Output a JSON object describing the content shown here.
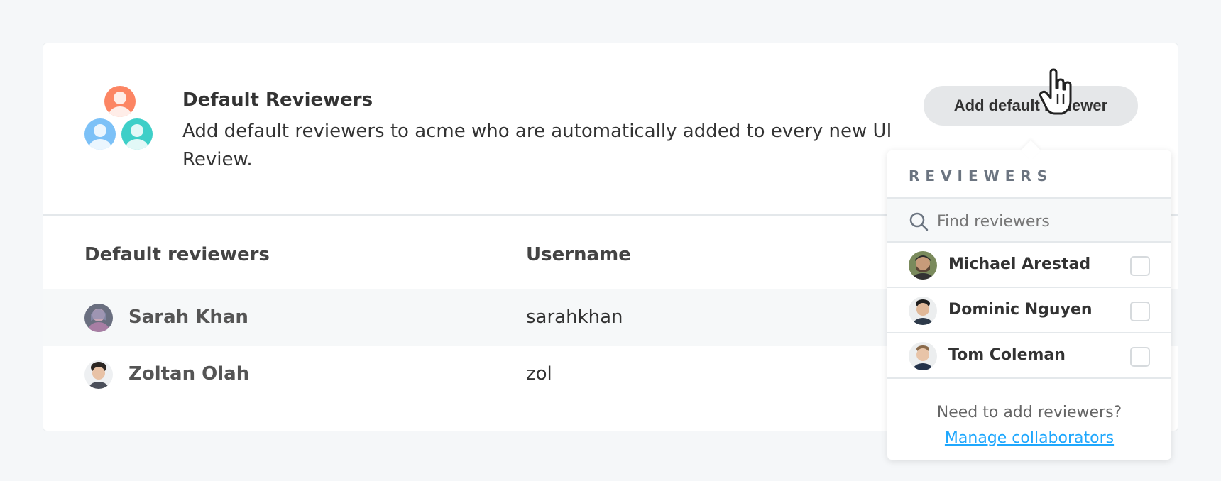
{
  "header": {
    "title": "Default Reviewers",
    "description": "Add default reviewers to acme who are automatically added to every new UI Review.",
    "add_button_label": "Add default reviewer"
  },
  "table": {
    "columns": [
      "Default reviewers",
      "Username"
    ],
    "rows": [
      {
        "name": "Sarah Khan",
        "username": "sarahkhan"
      },
      {
        "name": "Zoltan Olah",
        "username": "zol"
      }
    ]
  },
  "dropdown": {
    "title": "REVIEWERS",
    "search_placeholder": "Find reviewers",
    "items": [
      {
        "name": "Michael Arestad",
        "checked": false
      },
      {
        "name": "Dominic Nguyen",
        "checked": false
      },
      {
        "name": "Tom Coleman",
        "checked": false
      }
    ],
    "footer_text": "Need to add reviewers?",
    "footer_link": "Manage collaborators"
  },
  "colors": {
    "accent_link": "#1ea7fd",
    "avatar_orange": "#fc8563",
    "avatar_blue": "#7cc1f7",
    "avatar_teal": "#3ecfc8"
  }
}
